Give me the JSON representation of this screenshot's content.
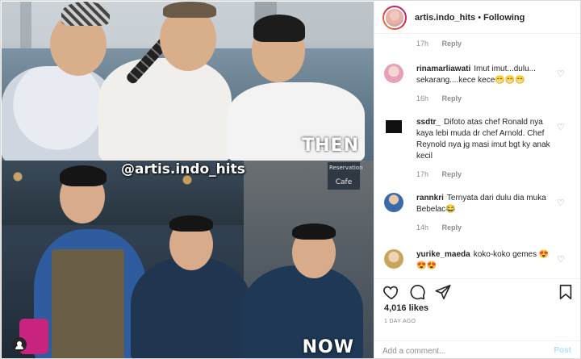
{
  "post_image": {
    "watermark": "@artis.indo_hits",
    "label_then": "THEN",
    "label_now": "NOW",
    "sign_top": "Reservation",
    "sign_bottom": "Cafe"
  },
  "header": {
    "username": "artis.indo_hits",
    "separator": "•",
    "follow_status": "Following"
  },
  "comments": {
    "first_meta": {
      "time": "17h",
      "reply": "Reply"
    },
    "items": [
      {
        "username": "rinamarliawati",
        "text": "Imut imut...dulu... sekarang....kece kece😁😁😁",
        "time": "16h",
        "reply": "Reply",
        "avatar_color": "#e6a0b8"
      },
      {
        "username": "ssdtr_",
        "text": "Difoto atas chef Ronald nya kaya lebi muda dr chef Arnold. Chef Reynold nya jg masi imut bgt ky anak kecil",
        "time": "17h",
        "reply": "Reply",
        "avatar_color": "#111111"
      },
      {
        "username": "rannkri",
        "text": "Ternyata dari dulu dia muka Bebelac😂",
        "time": "14h",
        "reply": "Reply",
        "avatar_color": "#3b6aa8"
      },
      {
        "username": "yurike_maeda",
        "text": "koko-koko gemes 😍😍😍",
        "time": "",
        "reply": "",
        "avatar_color": "#c9a45c"
      }
    ]
  },
  "actions": {
    "likes": "4,016 likes",
    "date": "1 DAY AGO"
  },
  "add_comment": {
    "placeholder": "Add a comment...",
    "post_label": "Post"
  },
  "colors": {
    "link_disabled": "#b2dffc",
    "muted": "#8e8e8e",
    "text": "#262626"
  },
  "icons": [
    "heart-icon",
    "comment-icon",
    "share-icon",
    "bookmark-icon",
    "tagged-person-icon"
  ]
}
